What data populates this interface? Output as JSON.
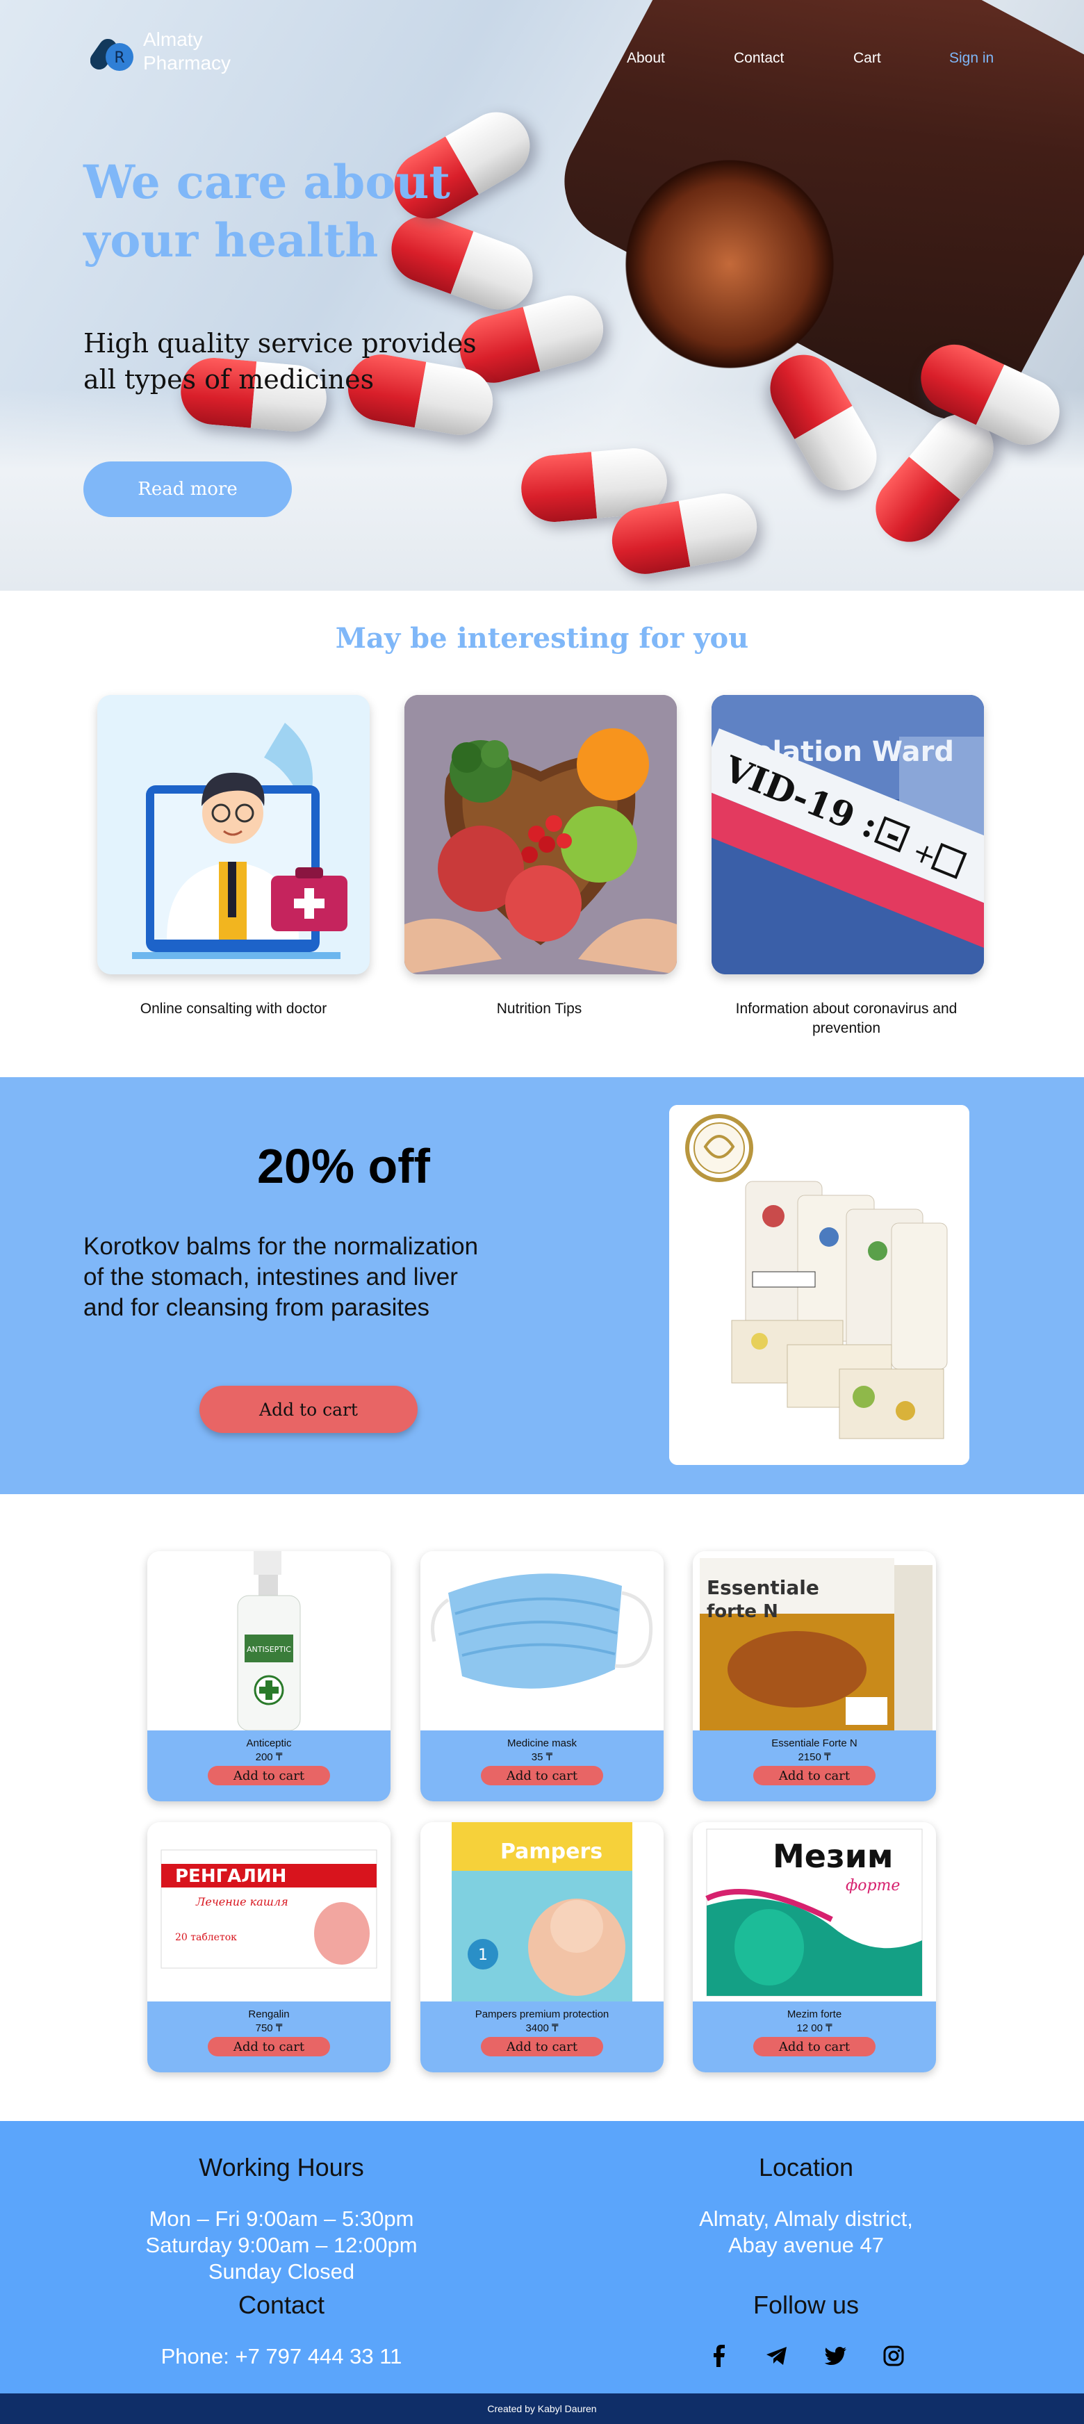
{
  "brand": {
    "name_line1": "Almaty",
    "name_line2": "Pharmacy"
  },
  "nav": {
    "about": "About",
    "contact": "Contact",
    "cart": "Cart",
    "signin": "Sign in"
  },
  "hero": {
    "title": "We care about your health",
    "subtitle": "High quality service provides all types of medicines",
    "button": "Read more"
  },
  "interesting": {
    "title": "May be interesting for you",
    "cards": [
      {
        "caption": "Online consalting with doctor",
        "icon": "doctor-illustration"
      },
      {
        "caption": "Nutrition Tips",
        "icon": "fruit-bowl-photo"
      },
      {
        "caption": "Information about coronavirus and prevention",
        "icon": "covid-test-photo"
      }
    ]
  },
  "promo": {
    "title": "20% off",
    "text": "Korotkov balms for the normalization of the stomach, intestines and liver and for cleansing from parasites",
    "button": "Add to cart"
  },
  "products": [
    {
      "name": "Anticeptic",
      "price": "200 ₸",
      "button": "Add to cart"
    },
    {
      "name": "Medicine mask",
      "price": "35  ₸",
      "button": "Add to cart"
    },
    {
      "name": "Essentiale Forte N",
      "price": "2150 ₸",
      "button": "Add to cart"
    },
    {
      "name": "Rengalin",
      "price": "750 ₸",
      "button": "Add to cart"
    },
    {
      "name": "Pampers premium protection",
      "price": "3400 ₸",
      "button": "Add to cart"
    },
    {
      "name": "Mezim forte",
      "price": "12 00 ₸",
      "button": "Add to cart"
    }
  ],
  "product_labels": {
    "rengalin_brand": "РЕНГАЛИН",
    "rengalin_sub": "Лечение кашля",
    "rengalin_count": "20 таблеток",
    "essentiale_brand": "Essentiale",
    "essentiale_sub": "forte N",
    "pampers_brand": "Pampers",
    "mezim_brand": "Мезим",
    "mezim_sub": "форте"
  },
  "footer": {
    "hours_title": "Working Hours",
    "hours": [
      "Mon – Fri 9:00am – 5:30pm",
      "Saturday 9:00am – 12:00pm",
      "Sunday Closed"
    ],
    "location_title": "Location",
    "location": [
      "Almaty, Almaly district,",
      "Abay avenue 47"
    ],
    "contact_title": "Contact",
    "phone": "Phone: +7 797 444 33 11",
    "follow_title": "Follow us",
    "social": [
      "facebook-icon",
      "telegram-icon",
      "twitter-icon",
      "instagram-icon"
    ],
    "credit": "Created by Kabyl Dauren"
  },
  "colors": {
    "accent": "#7fb7f8",
    "cart_button": "#e86565",
    "footer": "#5ba5fb",
    "bottom_bar": "#0f2e68"
  }
}
